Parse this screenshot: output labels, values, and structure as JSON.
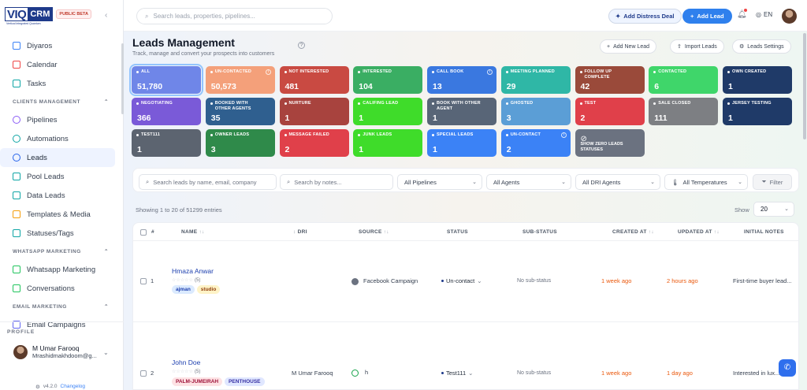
{
  "brand": {
    "name_a": "VIQ",
    "name_b": "CRM",
    "tagline": "Vertical Integrated Quantum",
    "badge": "PUBLIC BETA"
  },
  "sidebar": {
    "items_top": [
      {
        "label": "Diyaros",
        "icon": "external-link-icon"
      },
      {
        "label": "Calendar",
        "icon": "calendar-icon"
      },
      {
        "label": "Tasks",
        "icon": "tasks-icon"
      }
    ],
    "section_clients": "CLIENTS MANAGEMENT",
    "items_clients": [
      {
        "label": "Pipelines",
        "icon": "pipelines-icon"
      },
      {
        "label": "Automations",
        "icon": "automations-icon"
      },
      {
        "label": "Leads",
        "icon": "leads-icon"
      },
      {
        "label": "Pool Leads",
        "icon": "pool-leads-icon"
      },
      {
        "label": "Data Leads",
        "icon": "data-leads-icon"
      },
      {
        "label": "Templates & Media",
        "icon": "templates-icon"
      },
      {
        "label": "Statuses/Tags",
        "icon": "tags-icon"
      }
    ],
    "section_whatsapp": "WHATSAPP MARKETING",
    "items_whatsapp": [
      {
        "label": "Whatsapp Marketing",
        "icon": "chat-icon"
      },
      {
        "label": "Conversations",
        "icon": "chat-icon"
      }
    ],
    "section_email": "EMAIL MARKETING",
    "items_email": [
      {
        "label": "Email Campaigns",
        "icon": "mail-icon"
      }
    ],
    "profile": {
      "heading": "PROFILE",
      "name": "M Umar Farooq",
      "email": "Mrashidmakhdoom@g..."
    },
    "version": "v4.2.0",
    "changelog": "Changelog"
  },
  "topbar": {
    "search_placeholder": "Search leads, properties, pipelines...",
    "distress_label": "Add Distress Deal",
    "add_lead_label": "Add Lead",
    "lang": "EN"
  },
  "page": {
    "title": "Leads Management",
    "subtitle": "Track, manage and convert your prospects into customers",
    "add_new_lead": "Add New Lead",
    "import_leads": "Import Leads",
    "leads_settings": "Leads Settings"
  },
  "cards": [
    {
      "label": "ALL",
      "value": "51,780",
      "color": "#6f86e8"
    },
    {
      "label": "UN-CONTACTED",
      "value": "50,573",
      "color": "#f4a07a"
    },
    {
      "label": "NOT INTERESTED",
      "value": "481",
      "color": "#c94a42"
    },
    {
      "label": "INTERESTED",
      "value": "104",
      "color": "#3aae63"
    },
    {
      "label": "CALL BOOK",
      "value": "13",
      "color": "#3a78e0"
    },
    {
      "label": "MEETING PLANNED",
      "value": "29",
      "color": "#2fb7a6"
    },
    {
      "label": "FOLLOW UP COMPLETE",
      "value": "42",
      "color": "#9a4a3a"
    },
    {
      "label": "CONTACTED",
      "value": "6",
      "color": "#3fd66a"
    },
    {
      "label": "OWN CREATED",
      "value": "1",
      "color": "#1f3a68"
    },
    {
      "label": "NEGOTIATING",
      "value": "366",
      "color": "#7a5ad8"
    },
    {
      "label": "BOOKED WITH OTHER AGENTS",
      "value": "35",
      "color": "#2f5f8f"
    },
    {
      "label": "NURTURE",
      "value": "1",
      "color": "#a8433e"
    },
    {
      "label": "CALIFING LEAD",
      "value": "1",
      "color": "#3fdc2a"
    },
    {
      "label": "BOOK WITH OTHER AGENT",
      "value": "1",
      "color": "#586577"
    },
    {
      "label": "GHOSTED",
      "value": "3",
      "color": "#5b9ed6"
    },
    {
      "label": "TEST",
      "value": "2",
      "color": "#e0404a"
    },
    {
      "label": "SALE CLOSED",
      "value": "111",
      "color": "#7d7f83"
    },
    {
      "label": "JERSEY TESTING",
      "value": "1",
      "color": "#1f3a68"
    },
    {
      "label": "TEST111",
      "value": "1",
      "color": "#5c6470"
    },
    {
      "label": "OWNER LEADS",
      "value": "3",
      "color": "#2f8a4a"
    },
    {
      "label": "MESSAGE FAILED",
      "value": "2",
      "color": "#e0404a"
    },
    {
      "label": "JUNK LEADS",
      "value": "1",
      "color": "#3fdc2a"
    },
    {
      "label": "SPECIAL LEADS",
      "value": "1",
      "color": "#3b82f6"
    },
    {
      "label": "UN-CONTACT",
      "value": "2",
      "color": "#3b82f6"
    },
    {
      "label": "SHOW ZERO LEADS STATUSES",
      "value": "",
      "color": "#6b7280"
    }
  ],
  "filters": {
    "search_name_placeholder": "Search leads by name, email, company",
    "search_notes_placeholder": "Search by notes...",
    "pipelines": "All Pipelines",
    "agents": "All Agents",
    "dri_agents": "All DRI Agents",
    "temperatures": "All Temperatures",
    "filter_label": "Filter"
  },
  "listing": {
    "showing": "Showing 1 to 20 of 51299 entries",
    "show_label": "Show",
    "show_value": "20"
  },
  "table": {
    "headers": {
      "num": "#",
      "name": "NAME",
      "dri": "DRI",
      "source": "SOURCE",
      "status": "STATUS",
      "sub_status": "SUB-STATUS",
      "created": "CREATED AT",
      "updated": "UPDATED AT",
      "notes": "INITIAL NOTES"
    },
    "rows": [
      {
        "num": "1",
        "name": "Hmaza Anwar",
        "rating": "(5)",
        "tags": [
          "ajman",
          "studio"
        ],
        "dri": "",
        "source": "Facebook Campaign",
        "status": "Un-contact",
        "sub_status": "No sub-status",
        "created": "1 week ago",
        "updated": "2 hours ago",
        "notes": "First-time buyer lead..."
      },
      {
        "num": "2",
        "name": "John Doe",
        "rating": "(5)",
        "tags": [
          "PALM-JUMEIRAH",
          "PENTHOUSE"
        ],
        "dri": "M Umar Farooq",
        "source": "h",
        "status": "Test111",
        "sub_status": "No sub-status",
        "created": "1 week ago",
        "updated": "1 day ago",
        "notes": "Interested in lux..."
      }
    ]
  }
}
